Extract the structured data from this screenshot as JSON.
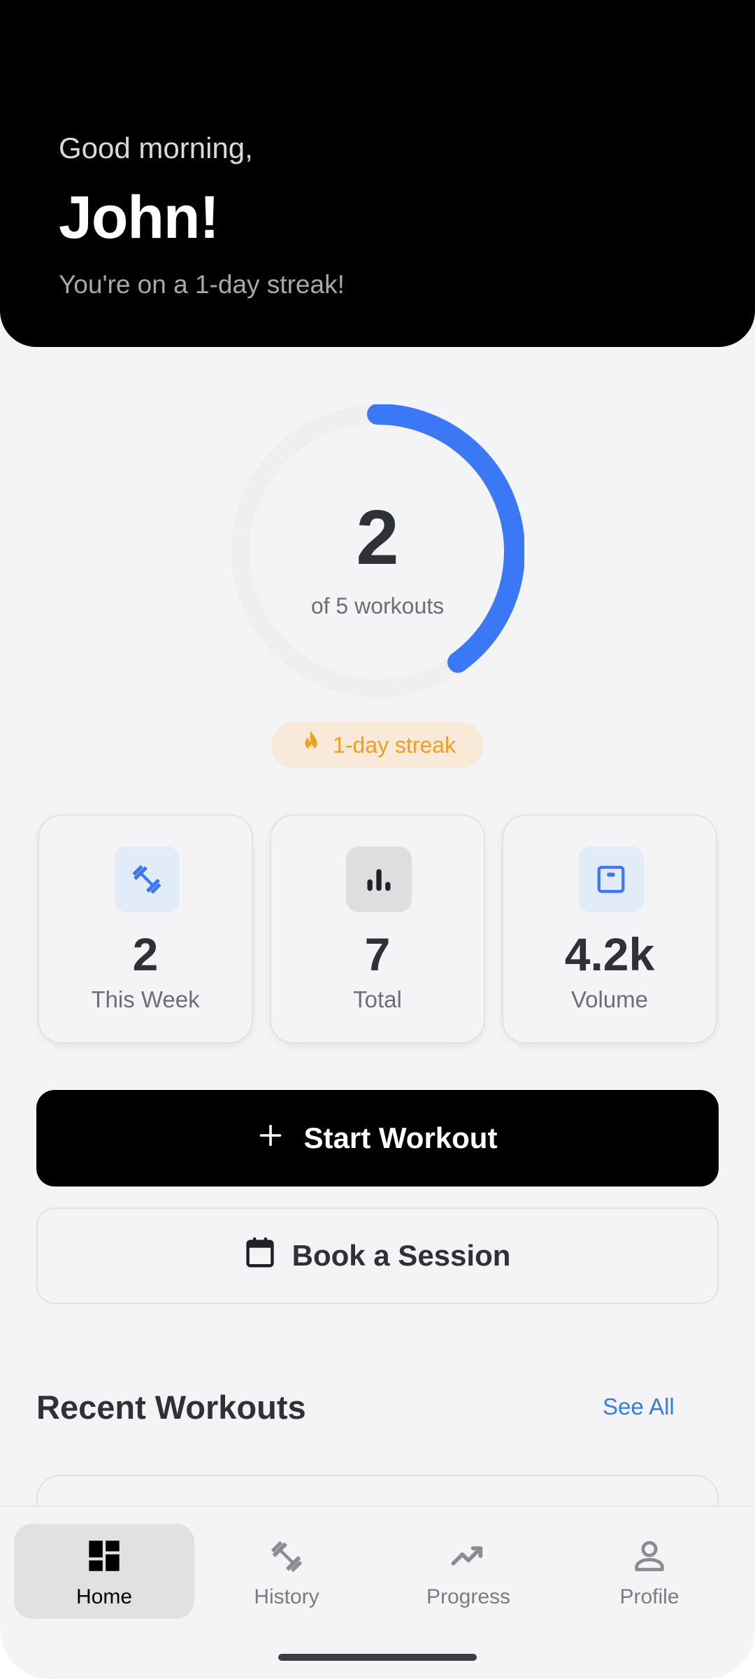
{
  "header": {
    "greeting": "Good morning,",
    "name": "John!",
    "streak_text": "You're on a 1-day streak!"
  },
  "progress": {
    "completed": "2",
    "caption": "of 5 workouts",
    "fraction": 0.4
  },
  "streak_badge": {
    "label": "1-day streak",
    "icon": "flame-icon",
    "color": "#f0a020"
  },
  "stats": [
    {
      "value": "2",
      "label": "This Week",
      "icon": "dumbbell-icon"
    },
    {
      "value": "7",
      "label": "Total",
      "icon": "bar-chart-icon"
    },
    {
      "value": "4.2k",
      "label": "Volume",
      "icon": "scale-icon"
    }
  ],
  "actions": {
    "start_workout": "Start Workout",
    "book_session": "Book a Session"
  },
  "recent": {
    "title": "Recent Workouts",
    "see_all": "See All"
  },
  "nav": [
    {
      "label": "Home",
      "icon": "dashboard-icon",
      "active": true
    },
    {
      "label": "History",
      "icon": "dumbbell-icon",
      "active": false
    },
    {
      "label": "Progress",
      "icon": "trending-up-icon",
      "active": false
    },
    {
      "label": "Profile",
      "icon": "person-icon",
      "active": false
    }
  ],
  "colors": {
    "accent": "#3b78f5",
    "streak": "#f0a020",
    "header_bg": "#000000"
  }
}
